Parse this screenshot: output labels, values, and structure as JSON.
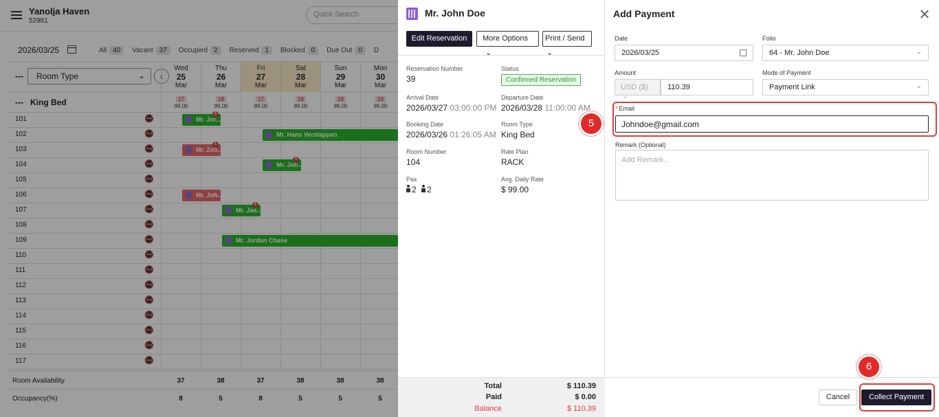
{
  "app": {
    "property_name": "Yanolja Haven",
    "property_id": "52981",
    "search_placeholder": "Quick Search"
  },
  "calendar": {
    "date": "2026/03/25",
    "filters": [
      {
        "label": "All",
        "count": "40"
      },
      {
        "label": "Vacant",
        "count": "37"
      },
      {
        "label": "Occupied",
        "count": "2"
      },
      {
        "label": "Reserved",
        "count": "1"
      },
      {
        "label": "Blocked",
        "count": "0"
      },
      {
        "label": "Due Out",
        "count": "0"
      },
      {
        "label": "D",
        "count": ""
      }
    ],
    "room_type_label": "Room Type",
    "room_type_dash": "---",
    "days": [
      {
        "dow": "Wed",
        "num": "25",
        "mon": "Mar"
      },
      {
        "dow": "Thu",
        "num": "26",
        "mon": "Mar"
      },
      {
        "dow": "Fri",
        "num": "27",
        "mon": "Mar"
      },
      {
        "dow": "Sat",
        "num": "28",
        "mon": "Mar"
      },
      {
        "dow": "Sun",
        "num": "29",
        "mon": "Mar"
      },
      {
        "dow": "Mon",
        "num": "30",
        "mon": "Mar"
      }
    ],
    "king_bed_label": "King Bed",
    "king_bed_dash": "---",
    "king_bed_counts": [
      "17",
      "18",
      "17",
      "18",
      "18",
      "18"
    ],
    "king_bed_rate": "99.00",
    "rooms": [
      "101",
      "102",
      "103",
      "104",
      "105",
      "106",
      "107",
      "108",
      "109",
      "110",
      "111",
      "112",
      "113",
      "114",
      "115",
      "116",
      "117"
    ],
    "bookings": [
      {
        "name": "Mr. Jor...",
        "color": "green",
        "badge": "$"
      },
      {
        "name": "Mr. Hans Verstappen",
        "color": "green",
        "badge": ""
      },
      {
        "name": "Mr. Zeb...",
        "color": "red",
        "badge": "$"
      },
      {
        "name": "Mr. Joh...",
        "color": "green",
        "badge": "$"
      },
      {
        "name": "Mr. Joh...",
        "color": "red",
        "badge": ""
      },
      {
        "name": "Mr. Jas...",
        "color": "green",
        "badge": "$"
      },
      {
        "name": "Mr. Jordan Chase",
        "color": "green",
        "badge": ""
      }
    ],
    "availability_label": "Room Availability",
    "availability": [
      "37",
      "38",
      "37",
      "38",
      "38",
      "38"
    ],
    "occupancy_label": "Occupancy(%)",
    "occupancy": [
      "8",
      "5",
      "8",
      "5",
      "5",
      "5"
    ]
  },
  "reservation": {
    "guest_name": "Mr. John Doe",
    "edit_label": "Edit Reservation",
    "more_options_label": "More Options",
    "print_send_label": "Print / Send",
    "reservation_number_label": "Reservation Number",
    "reservation_number": "39",
    "status_label": "Status",
    "status": "Confirmed Reservation",
    "arrival_label": "Arrival Date",
    "arrival_date": "2026/03/27",
    "arrival_time": "03:00:00 PM",
    "departure_label": "Departure Date",
    "departure_date": "2026/03/28",
    "departure_time": "11:00:00 AM",
    "booking_label": "Booking Date",
    "booking_date": "2026/03/26",
    "booking_time": "01:26:05 AM",
    "room_type_label": "Room Type",
    "room_type": "King Bed",
    "room_number_label": "Room Number",
    "room_number": "104",
    "rate_plan_label": "Rate Plan",
    "rate_plan": "RACK",
    "pax_label": "Pax",
    "pax_adults": "2",
    "pax_children": "2",
    "adr_label": "Avg. Daily Rate",
    "adr": "$ 99.00",
    "total_label": "Total",
    "total": "$ 110.39",
    "paid_label": "Paid",
    "paid": "$ 0.00",
    "balance_label": "Balance",
    "balance": "$ 110.39"
  },
  "payment": {
    "title": "Add Payment",
    "date_label": "Date",
    "date": "2026/03/25",
    "folio_label": "Folio",
    "folio": "64 - Mr. John Doe",
    "amount_label": "Amount",
    "currency": "USD ($)",
    "amount": "110.39",
    "mode_label": "Mode of Payment",
    "mode": "Payment Link",
    "email_label": "Email",
    "email": "Johndoe@gmail.com",
    "remark_label": "Remark (Optional)",
    "remark_placeholder": "Add Remark..",
    "cancel_label": "Cancel",
    "collect_label": "Collect Payment"
  },
  "annotations": {
    "step_email": "5",
    "step_collect": "6"
  },
  "colors": {
    "primary_dark": "#1e1b2e",
    "booking_green": "#2db52d",
    "booking_red": "#e76a6a",
    "highlight_red": "#e32a2a",
    "status_green": "#2e9a2e"
  }
}
